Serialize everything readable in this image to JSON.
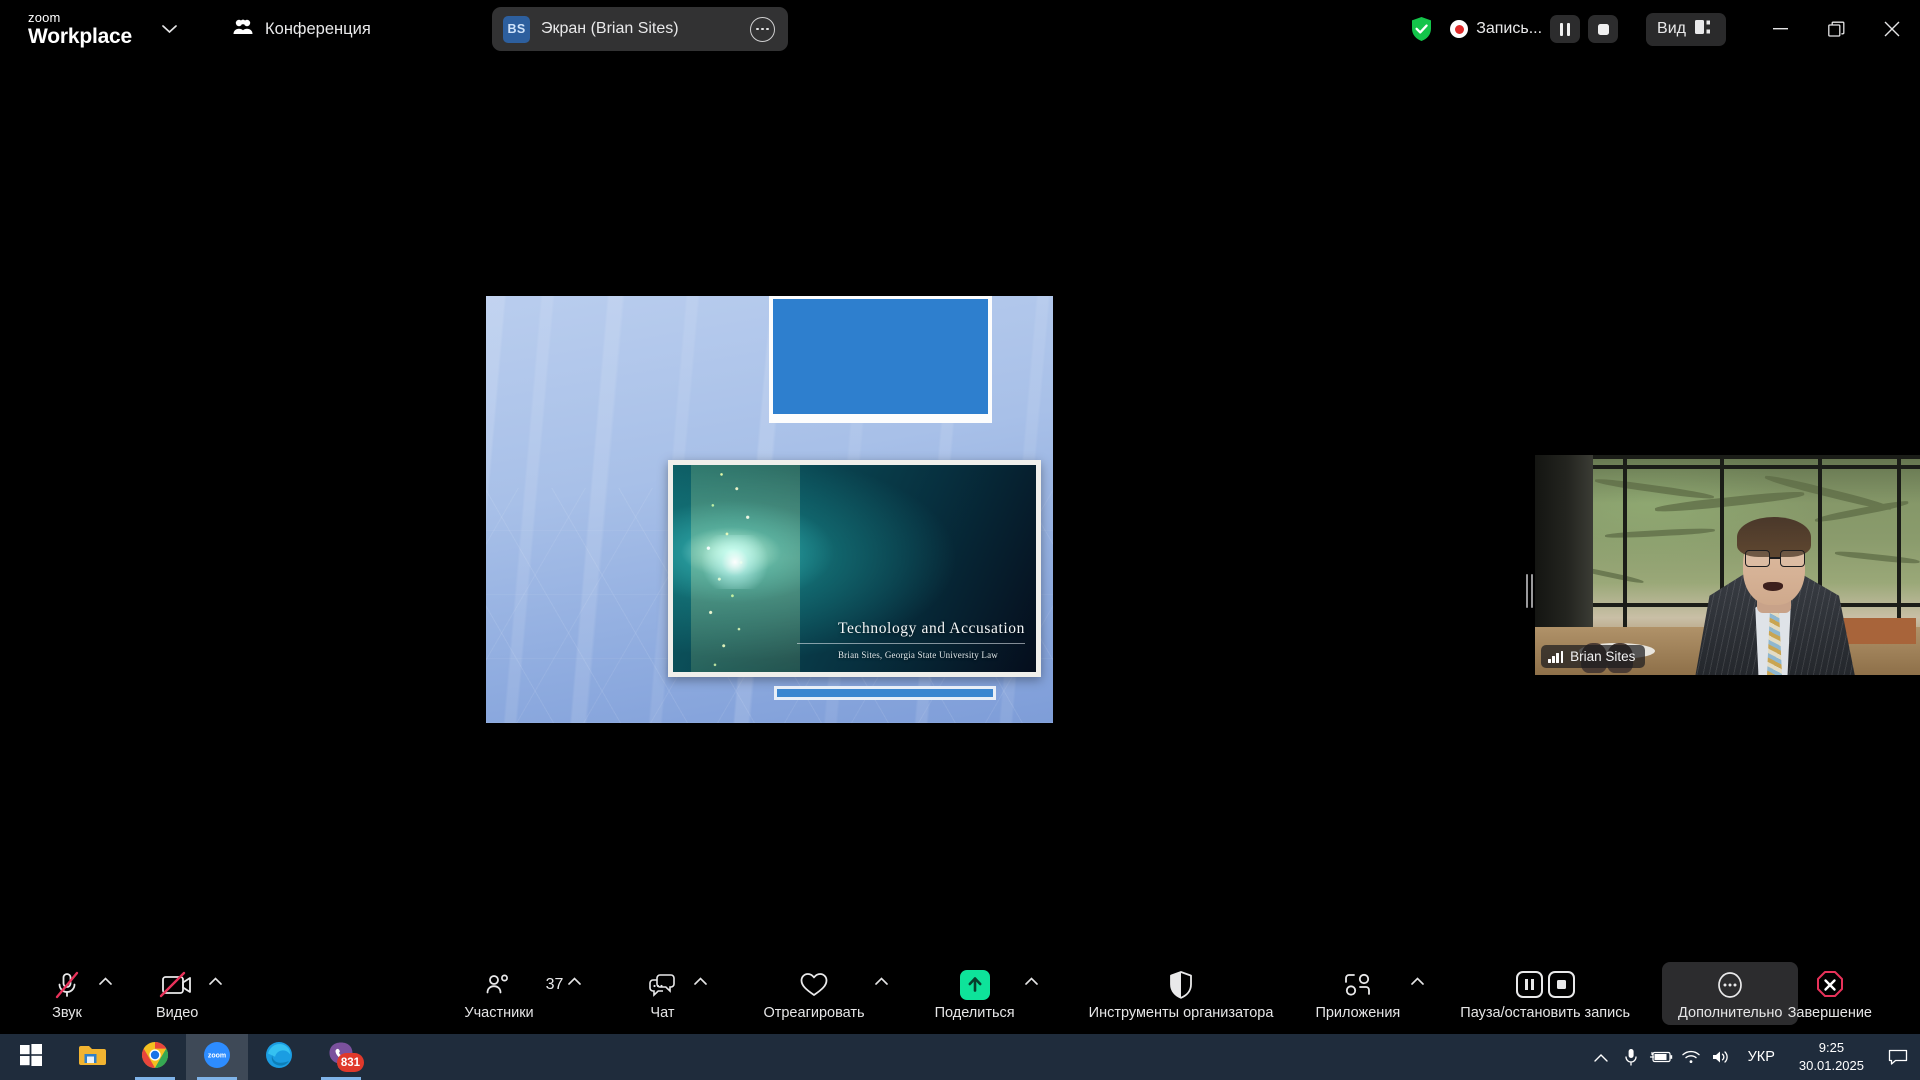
{
  "titlebar": {
    "logo_line1": "zoom",
    "logo_line2": "Workplace",
    "dropdown_icon": "chevron-down-icon",
    "conference_label": "Конференция",
    "conference_icon": "people-icon",
    "share_tab": {
      "avatar_initials": "BS",
      "label": "Экран (Brian Sites)",
      "more_icon": "more-options-icon"
    },
    "encryption_icon": "green-shield-check-icon",
    "recording_label": "Запись...",
    "recording_dot_icon": "record-dot-icon",
    "pause_icon": "pause-icon",
    "stop_icon": "stop-icon",
    "view_label": "Вид",
    "view_icon": "layout-icon",
    "window_minimize": "minimize-icon",
    "window_restore": "restore-icon",
    "window_close": "close-icon"
  },
  "shared_screen": {
    "slide_title": "Technology and Accusation",
    "slide_subtitle": "Brian Sites, Georgia State University Law"
  },
  "video_tile": {
    "participant_name": "Brian Sites",
    "signal_icon": "signal-bars-icon"
  },
  "toolbar": {
    "items": [
      {
        "label": "Звук",
        "icon": "microphone-muted-icon",
        "caret": true
      },
      {
        "label": "Видео",
        "icon": "camera-muted-icon",
        "caret": true
      },
      {
        "label": "Участники",
        "icon": "participants-icon",
        "count": "37",
        "caret": true
      },
      {
        "label": "Чат",
        "icon": "chat-icon",
        "caret": true
      },
      {
        "label": "Отреагировать",
        "icon": "heart-icon",
        "caret": true
      },
      {
        "label": "Поделиться",
        "icon": "share-screen-icon",
        "caret": true
      },
      {
        "label": "Инструменты организатора",
        "icon": "host-tools-shield-icon",
        "caret": false
      },
      {
        "label": "Приложения",
        "icon": "apps-icon",
        "caret": true
      },
      {
        "label": "Пауза/остановить запись",
        "icon": "pause-stop-recording-icon",
        "caret": false
      },
      {
        "label": "Дополнительно",
        "icon": "more-dots-icon",
        "caret": false
      },
      {
        "label": "Завершение",
        "icon": "end-meeting-icon",
        "caret": false
      }
    ]
  },
  "windows_taskbar": {
    "apps": [
      {
        "name": "start-button",
        "icon": "windows-logo-icon"
      },
      {
        "name": "file-explorer",
        "icon": "folder-icon"
      },
      {
        "name": "google-chrome",
        "icon": "chrome-icon"
      },
      {
        "name": "zoom",
        "icon": "zoom-icon"
      },
      {
        "name": "microsoft-edge",
        "icon": "edge-icon"
      },
      {
        "name": "viber",
        "icon": "viber-icon",
        "badge": "831"
      }
    ],
    "tray": {
      "expand_icon": "chevron-up-icon",
      "microphone_icon": "microphone-icon",
      "battery_icon": "battery-charging-icon",
      "wifi_icon": "wifi-icon",
      "volume_icon": "speaker-icon",
      "language": "УКР",
      "time": "9:25",
      "date": "30.01.2025",
      "notifications_icon": "notification-icon"
    }
  },
  "colors": {
    "accent_green": "#0ee39a",
    "record_red": "#e02b2b",
    "end_red": "#e8325a",
    "taskbar": "#1f2c3c",
    "tab_bg": "#323233"
  }
}
